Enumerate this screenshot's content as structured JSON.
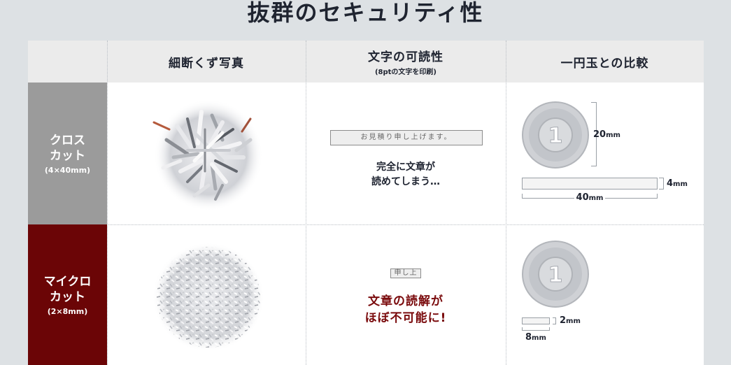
{
  "title": "抜群のセキュリティ性",
  "headers": {
    "photo": "細断くず写真",
    "readability": "文字の可読性",
    "readability_sub": "(8ptの文字を印刷)",
    "coin": "一円玉との比較"
  },
  "rows": [
    {
      "label_line1": "クロス",
      "label_line2": "カット",
      "label_size": "(4×40mm)",
      "sample_text": "お見積り申し上げます。",
      "note_line1": "完全に文章が",
      "note_line2": "読めてしまう…",
      "dim_height_value": "20",
      "dim_width_value": "40",
      "dim_strip_height_value": "4",
      "unit": "mm"
    },
    {
      "label_line1": "マイクロ",
      "label_line2": "カット",
      "label_size": "(2×8mm)",
      "sample_text": "申し上",
      "note_line1": "文章の読解が",
      "note_line2": "ほぼ不可能に!",
      "dim_width_value": "8",
      "dim_strip_height_value": "2",
      "unit": "mm"
    }
  ],
  "colors": {
    "cross_label_bg": "#9b9b9b",
    "micro_label_bg": "#6b0506",
    "micro_note": "#7a0a0c",
    "header_bg": "#ebebeb",
    "page_bg": "#dde1e4"
  },
  "icons": [
    "one-yen-coin-icon",
    "shredded-paper-cross-cut-image",
    "shredded-paper-micro-cut-image"
  ]
}
